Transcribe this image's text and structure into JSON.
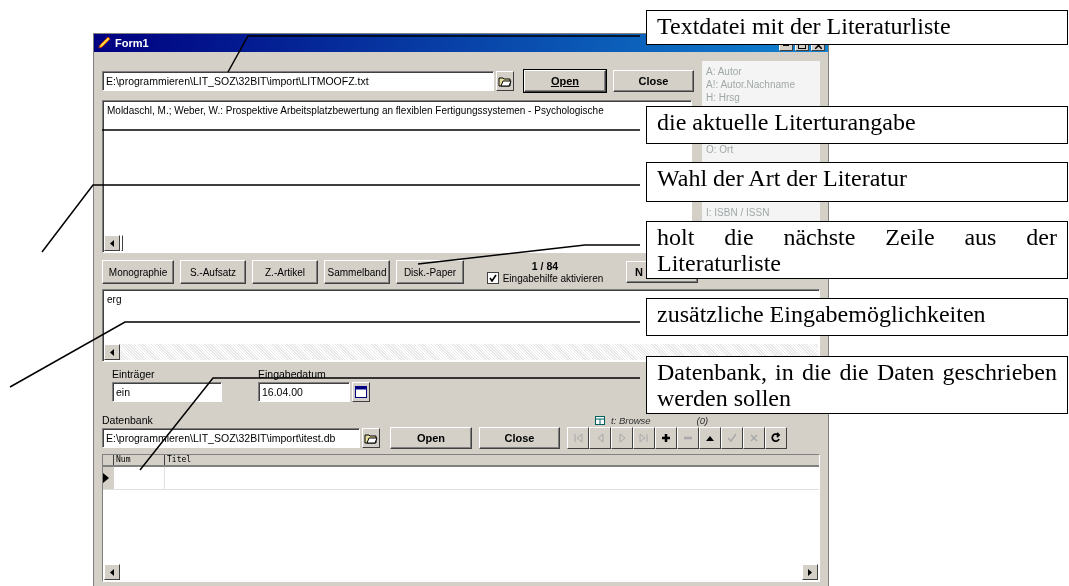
{
  "window": {
    "title": "Form1"
  },
  "source": {
    "path": "E:\\programmieren\\LIT_SOZ\\32BIT\\import\\LITMOOFZ.txt",
    "buttons": [
      {
        "label": "Open",
        "focused": true
      },
      {
        "label": "Close",
        "focused": false
      }
    ]
  },
  "field_hints": [
    [
      "A: Autor",
      "A!: Autor.Nachname",
      "H: Hrsg"
    ],
    [
      "O: Ort"
    ],
    [
      "I: ISBN / ISSN"
    ]
  ],
  "current_entry": "Moldaschl, M.; Weber, W.: Prospektive Arbeitsplatzbewertung an flexiblen Fertigungssystemen - Psychologische",
  "type_buttons": [
    "Monographie",
    "S.-Aufsatz",
    "Z.-Artikel",
    "Sammelband",
    "Disk.-Paper"
  ],
  "record_counter": "1 / 84",
  "assist": {
    "label": "Eingabehilfe aktivieren",
    "checked": true
  },
  "next_button": "N",
  "extra_input": "erg",
  "contributor": {
    "label": "Einträger",
    "value": "ein"
  },
  "entry_date": {
    "label": "Eingabedatum",
    "value": "16.04.00"
  },
  "database": {
    "label": "Datenbank",
    "path": "E:\\programmieren\\LIT_SOZ\\32BIT\\import\\itest.db",
    "buttons": [
      {
        "label": "Open",
        "focused": false
      },
      {
        "label": "Close",
        "focused": false
      }
    ],
    "mode": "t: Browse",
    "count": "(0)"
  },
  "navigator": [
    {
      "kind": "first",
      "disabled": true
    },
    {
      "kind": "prior",
      "disabled": true
    },
    {
      "kind": "next",
      "disabled": true
    },
    {
      "kind": "last",
      "disabled": true
    },
    {
      "kind": "insert",
      "disabled": false
    },
    {
      "kind": "delete",
      "disabled": true
    },
    {
      "kind": "edit",
      "disabled": false
    },
    {
      "kind": "post",
      "disabled": true
    },
    {
      "kind": "cancel",
      "disabled": true
    },
    {
      "kind": "refresh",
      "disabled": false
    }
  ],
  "grid": {
    "columns": [
      "Num",
      "Titel"
    ]
  },
  "callouts": [
    "Textdatei mit der Literaturliste",
    "die aktuelle Literturangabe",
    "Wahl der Art der Literatur",
    "holt die nächste Zeile aus der Literaturliste",
    "zusätzliche Eingabemöglichkeiten",
    "Datenbank, in die die Daten geschrieben werden sollen"
  ]
}
